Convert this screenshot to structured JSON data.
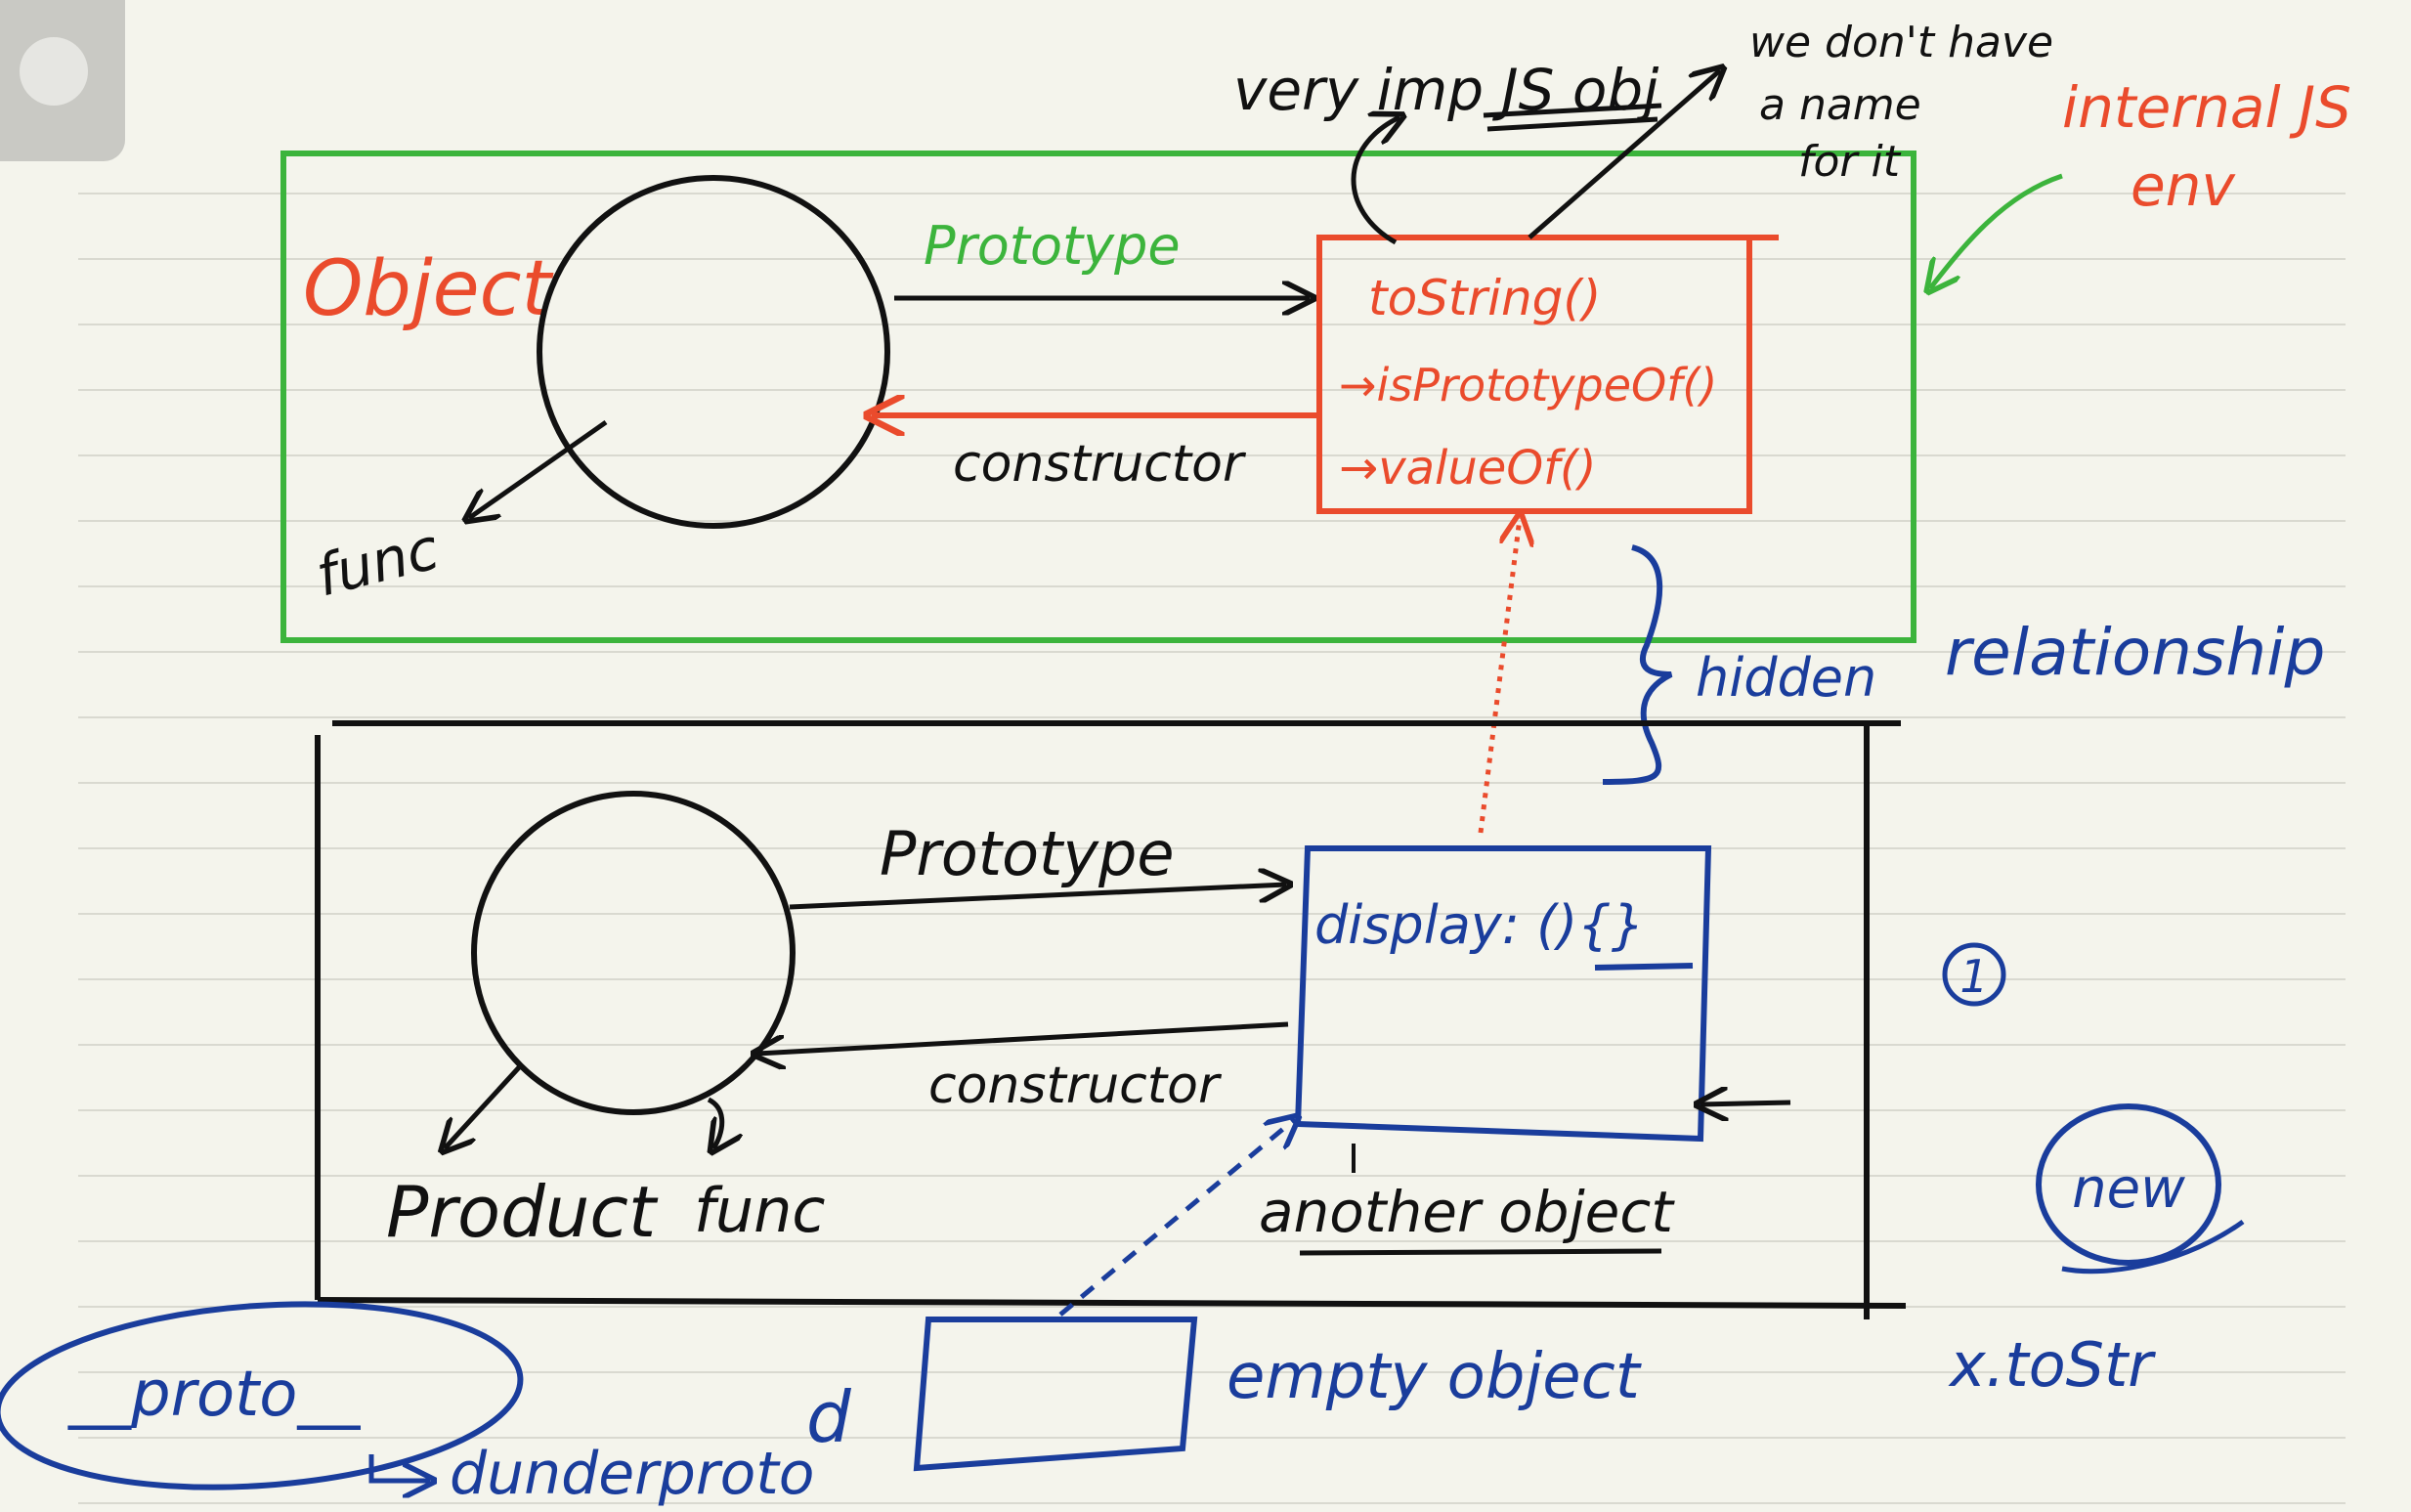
{
  "colors": {
    "paper": "#f4f4ec",
    "rule": "#d9d9d0",
    "green": "#3cb43c",
    "red": "#ea4b2c",
    "blue": "#1a3d9c",
    "ink": "#111111"
  },
  "top_section": {
    "object_label": "Object",
    "func_label": "func",
    "prototype_label": "Prototype",
    "constructor_label": "constructor",
    "methods": [
      "toString()",
      "→isPrototypeOf()",
      "→valueOf()"
    ],
    "note_line1": "very imp JS obj",
    "note_line2": "we don't have",
    "note_line3": "a name",
    "note_line4": "for it",
    "internal_label_line1": "internal JS",
    "internal_label_line2": "env"
  },
  "hidden_relationship": {
    "hidden_label": "hidden",
    "relationship_label": "relationship"
  },
  "bottom_section": {
    "prototype_label": "Prototype",
    "constructor_label": "constructor",
    "display_label": "display: (){}",
    "another_object_label": "another object",
    "product_label": "Product",
    "func_label": "func"
  },
  "proto_note": {
    "proto_label": "__proto__",
    "dunder_label": "dunderproto",
    "d_label": "d",
    "empty_object_label": "empty object"
  },
  "side_notes": {
    "circled_one": "1",
    "new_label": "new",
    "to_string_note": "x.toStr"
  }
}
